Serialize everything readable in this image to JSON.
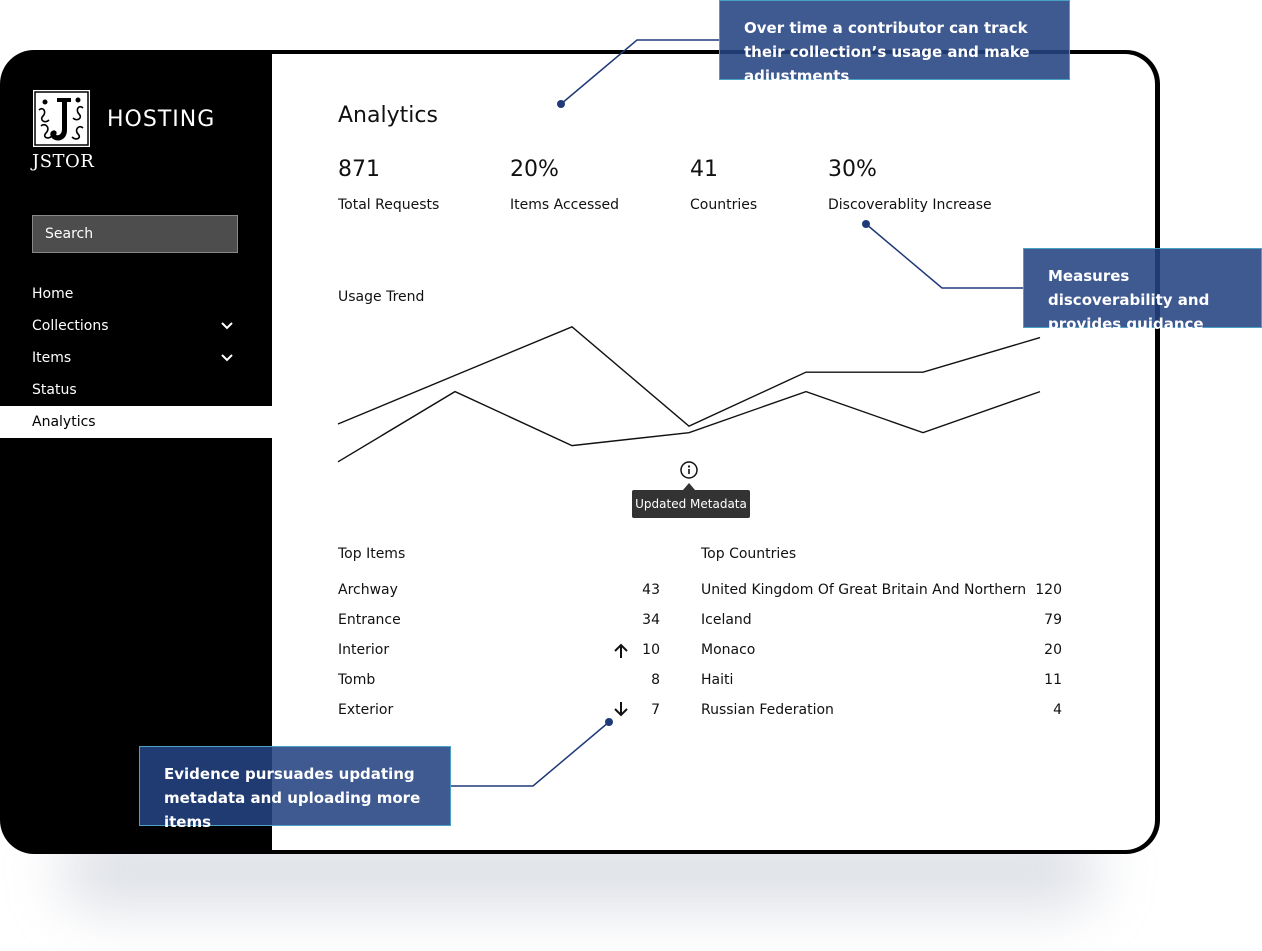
{
  "sidebar": {
    "brand": "HOSTING",
    "logo_text": "JSTOR",
    "search_placeholder": "Search",
    "items": [
      {
        "label": "Home"
      },
      {
        "label": "Collections"
      },
      {
        "label": "Items"
      },
      {
        "label": "Status"
      },
      {
        "label": "Analytics"
      }
    ],
    "active": "Analytics"
  },
  "main": {
    "title": "Analytics",
    "stats": [
      {
        "value": "871",
        "label": "Total Requests"
      },
      {
        "value": "20%",
        "label": "Items Accessed"
      },
      {
        "value": "41",
        "label": "Countries"
      },
      {
        "value": "30%",
        "label": "Discoverablity Increase"
      }
    ],
    "usage_trend_label": "Usage Trend",
    "tooltip": "Updated Metadata",
    "top_items": {
      "label": "Top Items",
      "rows": [
        {
          "name": "Archway",
          "value": "43",
          "trend": ""
        },
        {
          "name": "Entrance",
          "value": "34",
          "trend": ""
        },
        {
          "name": "Interior",
          "value": "10",
          "trend": "up"
        },
        {
          "name": "Tomb",
          "value": "8",
          "trend": ""
        },
        {
          "name": "Exterior",
          "value": "7",
          "trend": "down"
        }
      ]
    },
    "top_countries": {
      "label": "Top Countries",
      "rows": [
        {
          "name": "United Kingdom Of Great Britain And Northern",
          "value": "120"
        },
        {
          "name": "Iceland",
          "value": "79"
        },
        {
          "name": "Monaco",
          "value": "20"
        },
        {
          "name": "Haiti",
          "value": "11"
        },
        {
          "name": "Russian Federation",
          "value": "4"
        }
      ]
    }
  },
  "chart_data": {
    "type": "line",
    "title": "Usage Trend",
    "x": [
      1,
      2,
      3,
      4,
      5,
      6,
      7
    ],
    "series": [
      {
        "values": [
          10,
          55,
          100,
          8,
          58,
          58,
          90
        ]
      },
      {
        "values": [
          -25,
          40,
          -10,
          2,
          40,
          2,
          40
        ]
      }
    ],
    "ylim": [
      -40,
      110
    ],
    "grid": false,
    "annotation": {
      "x": 4,
      "label": "Updated Metadata"
    }
  },
  "callouts": {
    "top": "Over time a contributor can track their collection’s usage and make adjustments",
    "right": "Measures discoverability and provides guidance",
    "bottom": "Evidence pursuades updating metadata and uploading more items"
  },
  "colors": {
    "callout_bg": "#244382",
    "callout_border": "#4aa3c7",
    "leader_line": "#1e3a78"
  }
}
